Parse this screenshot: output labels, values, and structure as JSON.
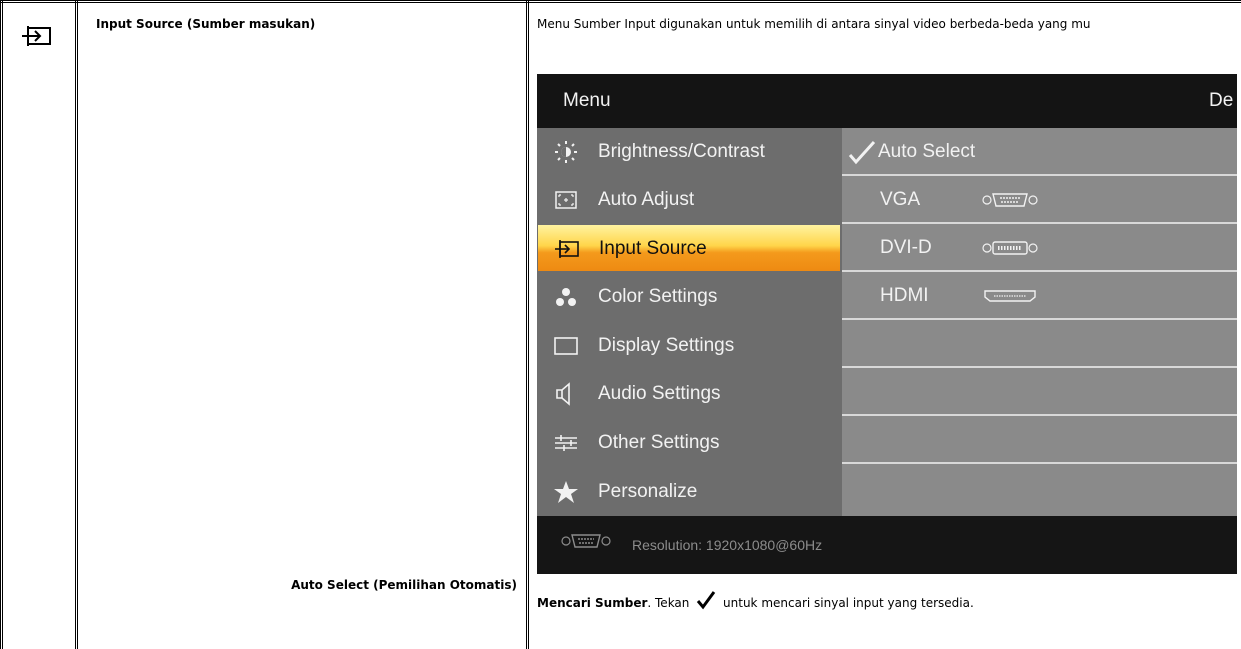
{
  "section": {
    "icon": "input-source-icon",
    "title": "Input Source (Sumber masukan)",
    "description": "Menu Sumber Input digunakan untuk memilih di antara sinyal video berbeda-beda yang mu"
  },
  "osd": {
    "header_title": "Menu",
    "header_right": "De",
    "menu_items": [
      {
        "label": "Brightness/Contrast",
        "icon": "brightness-icon"
      },
      {
        "label": "Auto Adjust",
        "icon": "auto-adjust-icon"
      },
      {
        "label": "Input Source",
        "icon": "input-source-icon",
        "active": true
      },
      {
        "label": "Color Settings",
        "icon": "color-settings-icon"
      },
      {
        "label": "Display Settings",
        "icon": "display-settings-icon"
      },
      {
        "label": "Audio Settings",
        "icon": "audio-settings-icon"
      },
      {
        "label": "Other Settings",
        "icon": "other-settings-icon"
      },
      {
        "label": "Personalize",
        "icon": "star-icon"
      }
    ],
    "options": [
      {
        "label": "Auto Select",
        "icon": "checkmark-icon",
        "selected": true
      },
      {
        "label": "VGA",
        "icon": "vga-connector-icon"
      },
      {
        "label": "DVI-D",
        "icon": "dvi-connector-icon"
      },
      {
        "label": "HDMI",
        "icon": "hdmi-connector-icon"
      },
      {
        "label": ""
      },
      {
        "label": ""
      },
      {
        "label": ""
      },
      {
        "label": ""
      }
    ],
    "footer": {
      "icon": "vga-connector-icon",
      "resolution_text": "Resolution: 1920x1080@60Hz"
    }
  },
  "sub_section": {
    "title": "Auto Select (Pemilihan Otomatis)",
    "desc_bold": "Mencari Sumber",
    "desc_after_bold": ". Tekan",
    "desc_icon": "checkmark-icon",
    "desc_rest": " untuk mencari sinyal input yang tersedia."
  },
  "colors": {
    "osd_left_bg": "#6d6d6d",
    "osd_right_bg": "#8a8a8a",
    "active_gradient_top": "#ffd54a",
    "active_gradient_bottom": "#ee8a12"
  }
}
